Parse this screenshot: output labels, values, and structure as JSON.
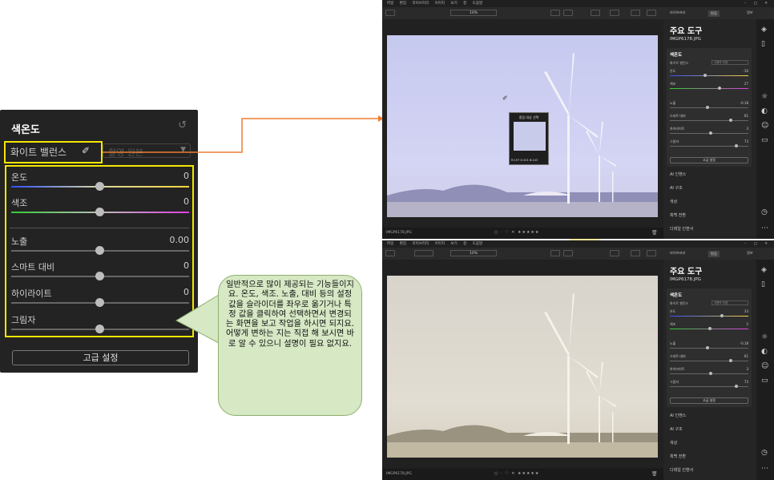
{
  "zoom_panel": {
    "title": "색온도",
    "reset_icon": "reset-icon",
    "white_balance_label": "화이트 밸런스",
    "white_balance_value": "촬영 원본",
    "sliders": [
      {
        "label": "온도",
        "value": "0",
        "level": 0.5
      },
      {
        "label": "색조",
        "value": "0",
        "level": 0.5
      },
      {
        "label": "노출",
        "value": "0.00",
        "level": 0.5
      },
      {
        "label": "스마트 대비",
        "value": "0",
        "level": 0.5
      },
      {
        "label": "하이라이트",
        "value": "0",
        "level": 0.5
      },
      {
        "label": "그림자",
        "value": "0",
        "level": 0.5
      }
    ],
    "advanced_button": "고급 설정"
  },
  "callout_text": "일반적으로 많이 제공되는 기능들이지요. 온도, 색조. 노출, 대비 등의 설정 값을 슬라이더를 좌우로 옮기거나 특정 값을 클릭하여 선택하면서 변경되는 화면을 보고 작업을 하시면 되지요. 어떻게 변하는 지는 직접 해 보시면 바로 알 수 있으니 설명이 필요 없지요.",
  "colors": {
    "highlight": "#f5e600",
    "arrow": "#ed7d31",
    "callout_bg": "#d6e8c4",
    "down_arrow": "#ffe699"
  },
  "screens": {
    "menu": [
      "파일",
      "편집",
      "라이브러리",
      "이미지",
      "보기",
      "창",
      "도움말"
    ],
    "zoom_value": "10%",
    "tabs": [
      "라이브러리",
      "편집",
      "정보"
    ],
    "panel_title": "주요 도구",
    "filename": "IMGP6178.JPG",
    "section_title": "색온도",
    "wb_label": "화이트 밸런스",
    "wb_value_top": "사용자 지정",
    "wb_value_bottom": "사용자 지정",
    "advanced": "고급 설정",
    "panel_list": [
      "AI 인핸스",
      "AI 구조",
      "색상",
      "흑백 전환",
      "디테일 인핸서"
    ],
    "picker_title": "중립 대상 선택",
    "picker_rgb": "R:197 G:201 B:243",
    "top_sliders": [
      {
        "label": "온도",
        "value": "-10",
        "level": 0.45
      },
      {
        "label": "색조",
        "value": "27",
        "level": 0.63
      },
      {
        "label": "노출",
        "value": "-0.18",
        "level": 0.48
      },
      {
        "label": "스마트 대비",
        "value": "61",
        "level": 0.78
      },
      {
        "label": "하이라이트",
        "value": "3",
        "level": 0.52
      },
      {
        "label": "그림자",
        "value": "73",
        "level": 0.85
      }
    ],
    "bottom_sliders": [
      {
        "label": "온도",
        "value": "33",
        "level": 0.66
      },
      {
        "label": "색조",
        "value": "2",
        "level": 0.51
      },
      {
        "label": "노출",
        "value": "-0.18",
        "level": 0.48
      },
      {
        "label": "스마트 대비",
        "value": "61",
        "level": 0.78
      },
      {
        "label": "하이라이트",
        "value": "3",
        "level": 0.52
      },
      {
        "label": "그림자",
        "value": "73",
        "level": 0.85
      }
    ],
    "status_filename": "IMGP6178.JPG",
    "rating": "○ · ♡ ✕ ★★★★★"
  }
}
